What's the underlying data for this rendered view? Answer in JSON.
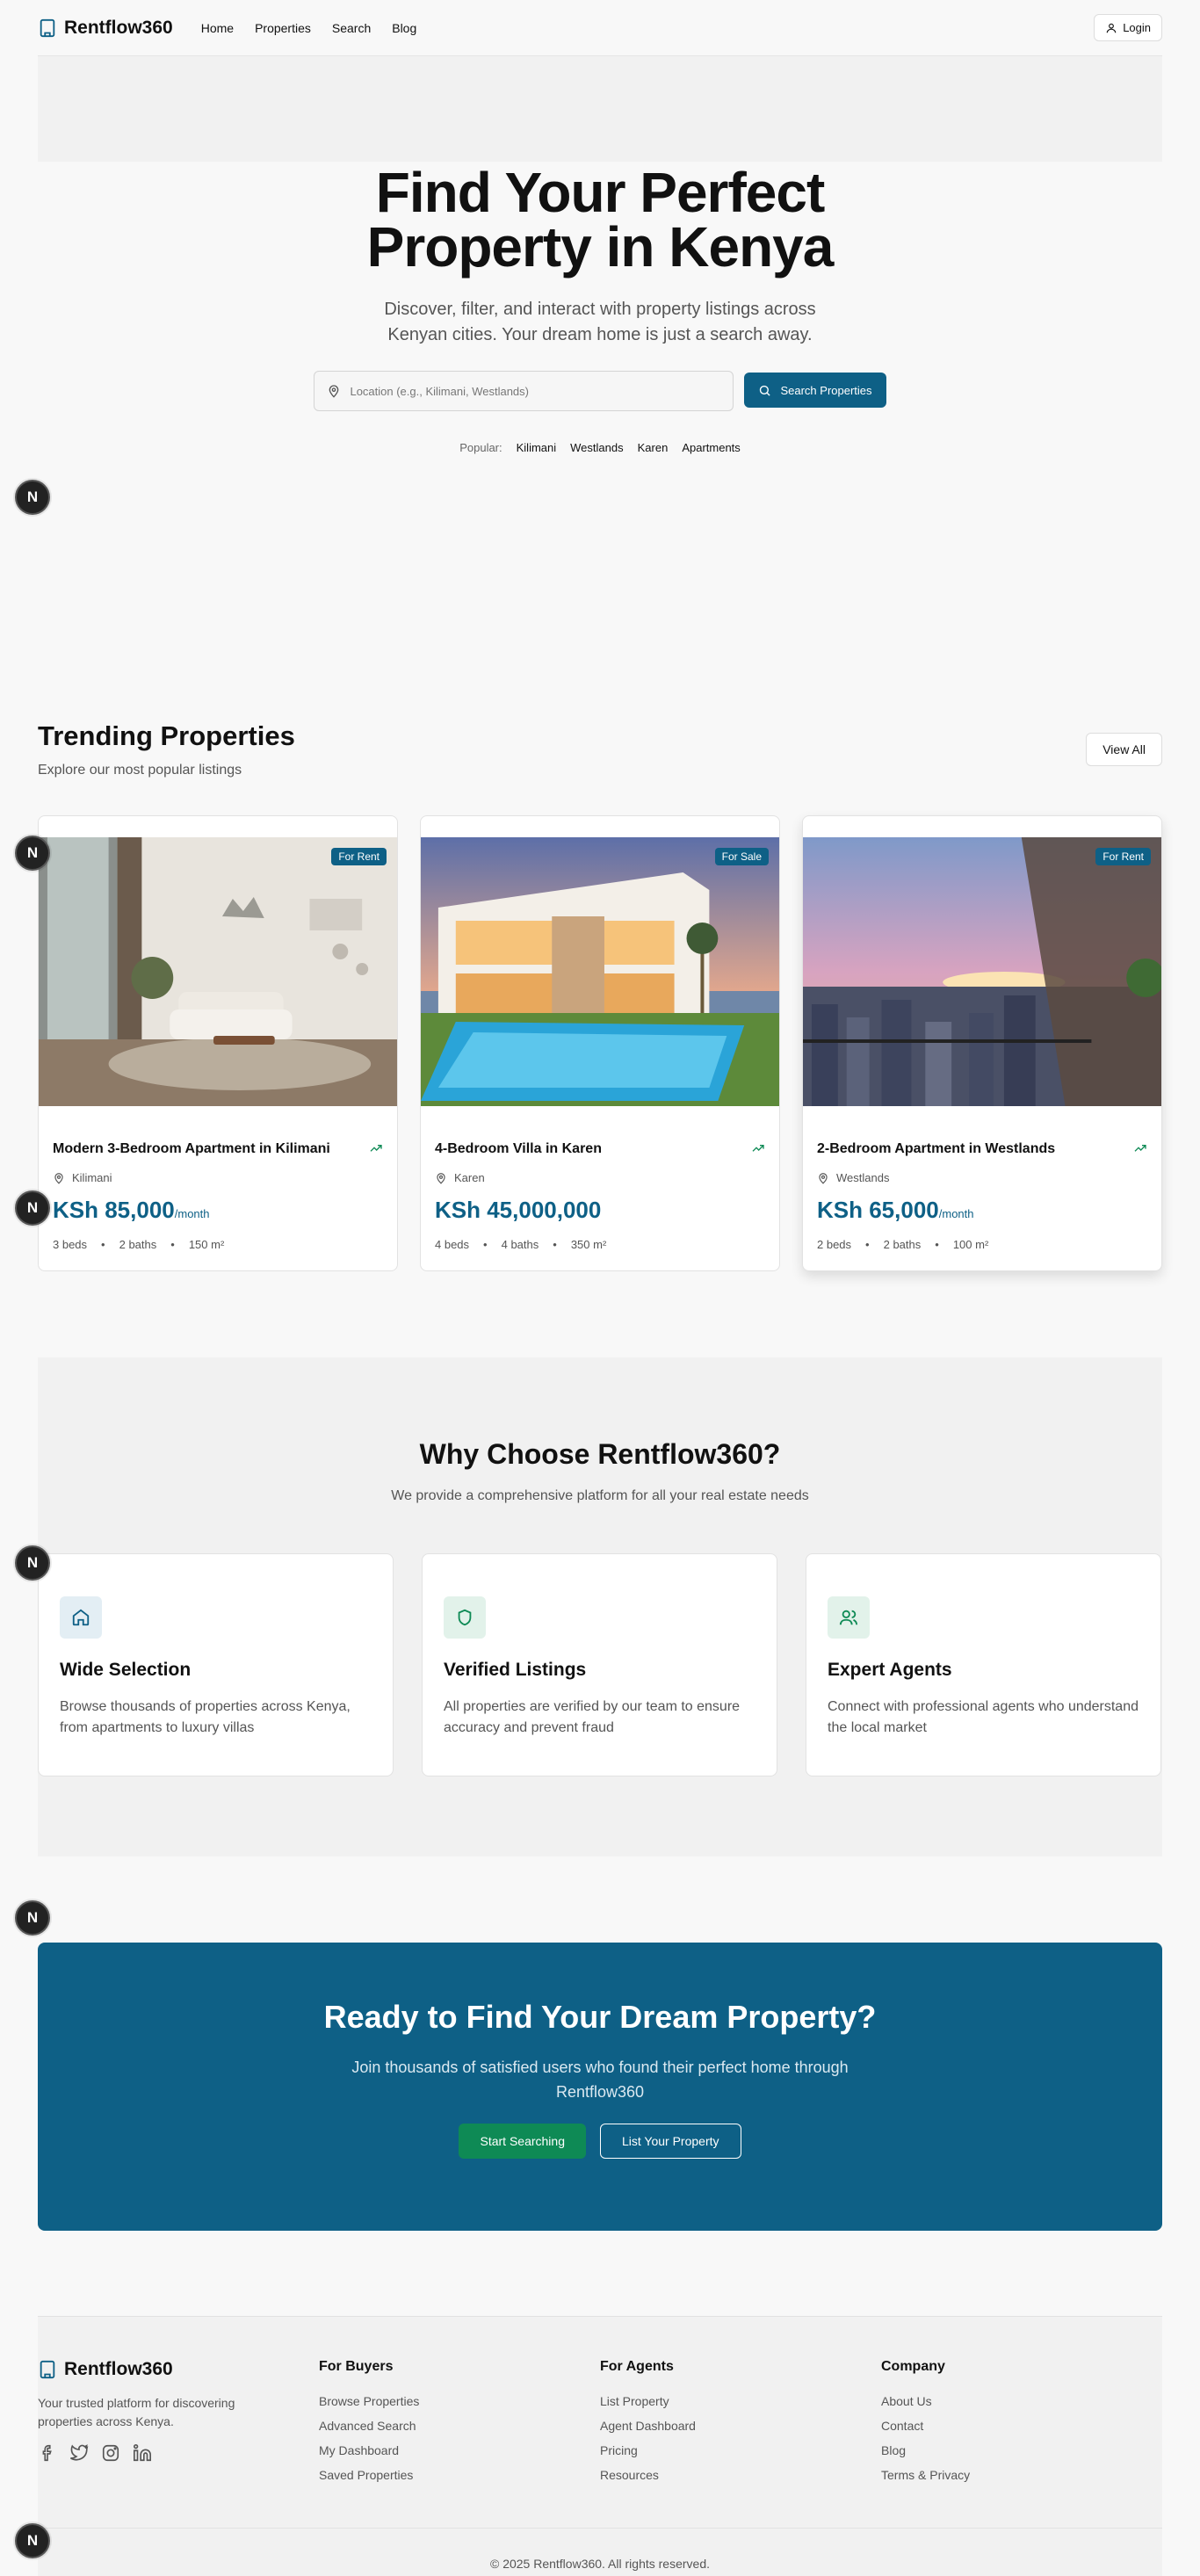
{
  "brand": {
    "name": "Rentflow360",
    "accent": "#0e6086",
    "green": "#0e8a55"
  },
  "nav": {
    "links": [
      "Home",
      "Properties",
      "Search",
      "Blog"
    ],
    "login": "Login"
  },
  "hero": {
    "title_line1": "Find Your Perfect",
    "title_line2": "Property in Kenya",
    "subtitle": "Discover, filter, and interact with property listings across Kenyan cities. Your dream home is just a search away.",
    "search_placeholder": "Location (e.g., Kilimani, Westlands)",
    "search_button": "Search Properties",
    "popular_label": "Popular:",
    "popular": [
      "Kilimani",
      "Westlands",
      "Karen",
      "Apartments"
    ]
  },
  "dev_badge": "N",
  "trending": {
    "title": "Trending Properties",
    "subtitle": "Explore our most popular listings",
    "view_all": "View All",
    "listings": [
      {
        "badge": "For Rent",
        "title": "Modern 3-Bedroom Apartment in Kilimani",
        "location": "Kilimani",
        "price": "KSh 85,000",
        "period": "/month",
        "beds": "3 beds",
        "baths": "2 baths",
        "area": "150 m²"
      },
      {
        "badge": "For Sale",
        "title": "4-Bedroom Villa in Karen",
        "location": "Karen",
        "price": "KSh 45,000,000",
        "period": "",
        "beds": "4 beds",
        "baths": "4 baths",
        "area": "350 m²"
      },
      {
        "badge": "For Rent",
        "title": "2-Bedroom Apartment in Westlands",
        "location": "Westlands",
        "price": "KSh 65,000",
        "period": "/month",
        "beds": "2 beds",
        "baths": "2 baths",
        "area": "100 m²"
      }
    ]
  },
  "why": {
    "title": "Why Choose Rentflow360?",
    "subtitle": "We provide a comprehensive platform for all your real estate needs",
    "items": [
      {
        "icon": "home-icon",
        "title": "Wide Selection",
        "text": "Browse thousands of properties across Kenya, from apartments to luxury villas"
      },
      {
        "icon": "shield-icon",
        "title": "Verified Listings",
        "text": "All properties are verified by our team to ensure accuracy and prevent fraud"
      },
      {
        "icon": "users-icon",
        "title": "Expert Agents",
        "text": "Connect with professional agents who understand the local market"
      }
    ]
  },
  "cta": {
    "title": "Ready to Find Your Dream Property?",
    "text": "Join thousands of satisfied users who found their perfect home through Rentflow360",
    "primary": "Start Searching",
    "secondary": "List Your Property"
  },
  "footer": {
    "description": "Your trusted platform for discovering properties across Kenya.",
    "columns": [
      {
        "title": "For Buyers",
        "links": [
          "Browse Properties",
          "Advanced Search",
          "My Dashboard",
          "Saved Properties"
        ]
      },
      {
        "title": "For Agents",
        "links": [
          "List Property",
          "Agent Dashboard",
          "Pricing",
          "Resources"
        ]
      },
      {
        "title": "Company",
        "links": [
          "About Us",
          "Contact",
          "Blog",
          "Terms & Privacy"
        ]
      }
    ],
    "copyright": "© 2025 Rentflow360. All rights reserved."
  }
}
